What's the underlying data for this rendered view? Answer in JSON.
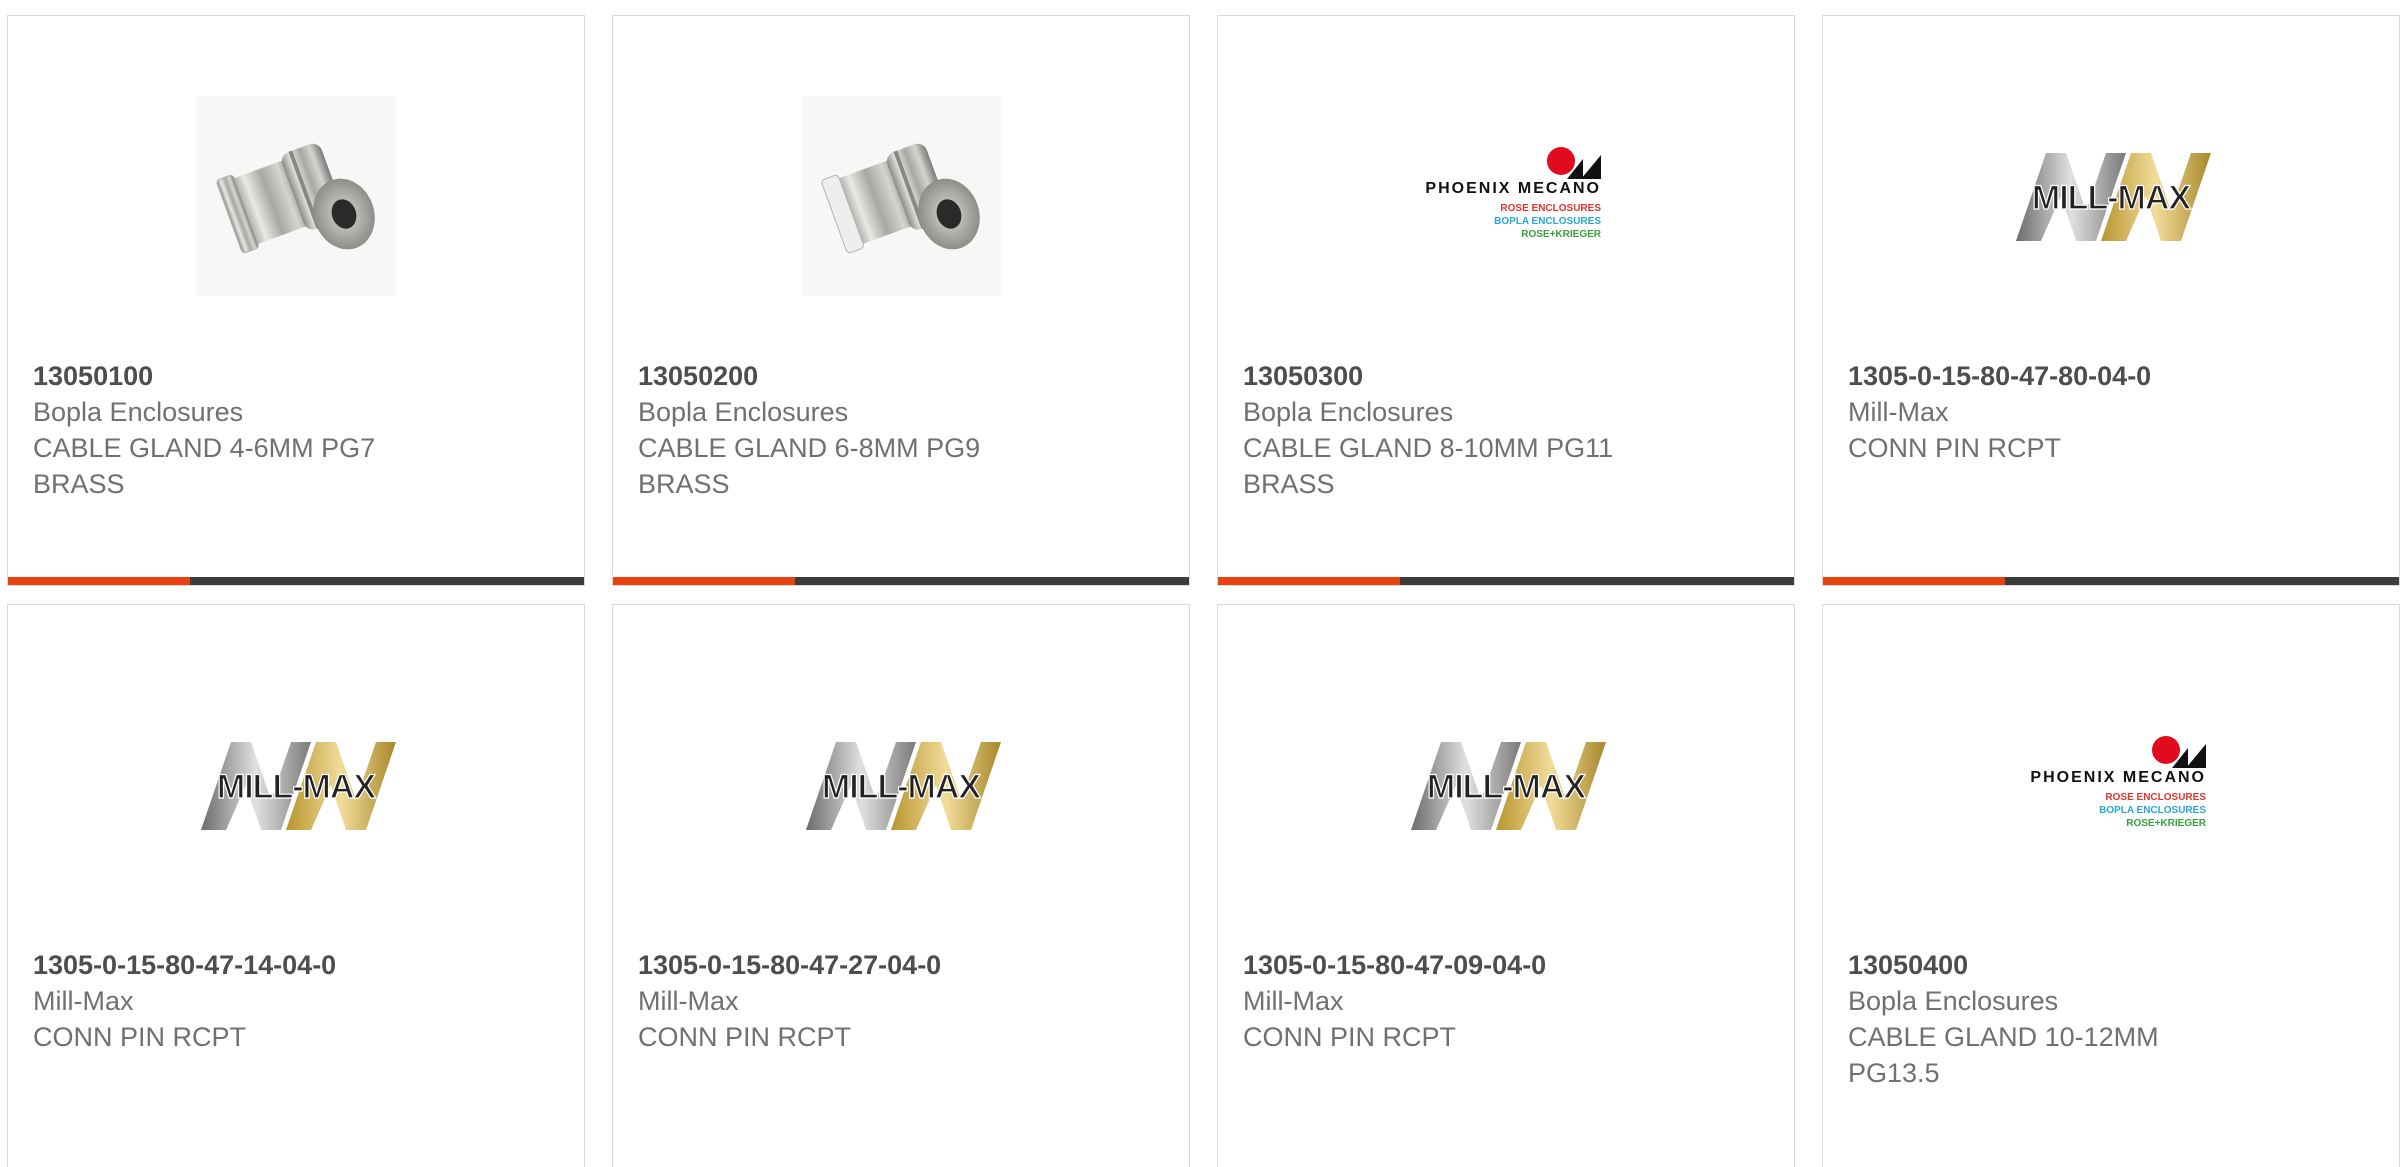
{
  "theme": {
    "accent": "#e8420f",
    "bar": "#3c3c3c",
    "border": "#d9d9d9"
  },
  "products": [
    {
      "part_number": "13050100",
      "manufacturer": "Bopla Enclosures",
      "description_lines": [
        "CABLE GLAND 4-6MM PG7",
        "BRASS"
      ],
      "image": "cable-gland-photo"
    },
    {
      "part_number": "13050200",
      "manufacturer": "Bopla Enclosures",
      "description_lines": [
        "CABLE GLAND 6-8MM PG9",
        "BRASS"
      ],
      "image": "cable-gland-photo"
    },
    {
      "part_number": "13050300",
      "manufacturer": "Bopla Enclosures",
      "description_lines": [
        "CABLE GLAND 8-10MM PG11",
        "BRASS"
      ],
      "image": "phoenix-mecano-logo"
    },
    {
      "part_number": "1305-0-15-80-47-80-04-0",
      "manufacturer": "Mill-Max",
      "description_lines": [
        "CONN PIN RCPT"
      ],
      "image": "mill-max-logo"
    },
    {
      "part_number": "1305-0-15-80-47-14-04-0",
      "manufacturer": "Mill-Max",
      "description_lines": [
        "CONN PIN RCPT"
      ],
      "image": "mill-max-logo"
    },
    {
      "part_number": "1305-0-15-80-47-27-04-0",
      "manufacturer": "Mill-Max",
      "description_lines": [
        "CONN PIN RCPT"
      ],
      "image": "mill-max-logo"
    },
    {
      "part_number": "1305-0-15-80-47-09-04-0",
      "manufacturer": "Mill-Max",
      "description_lines": [
        "CONN PIN RCPT"
      ],
      "image": "mill-max-logo"
    },
    {
      "part_number": "13050400",
      "manufacturer": "Bopla Enclosures",
      "description_lines": [
        "CABLE GLAND 10-12MM",
        "PG13.5"
      ],
      "image": "phoenix-mecano-logo"
    }
  ],
  "logos": {
    "phoenix": {
      "name": "PHOENIX MECANO",
      "line1": "ROSE ENCLOSURES",
      "line2": "BOPLA ENCLOSURES",
      "line3": "ROSE+KRIEGER"
    },
    "millmax": {
      "name": "MILL-MAX"
    }
  }
}
